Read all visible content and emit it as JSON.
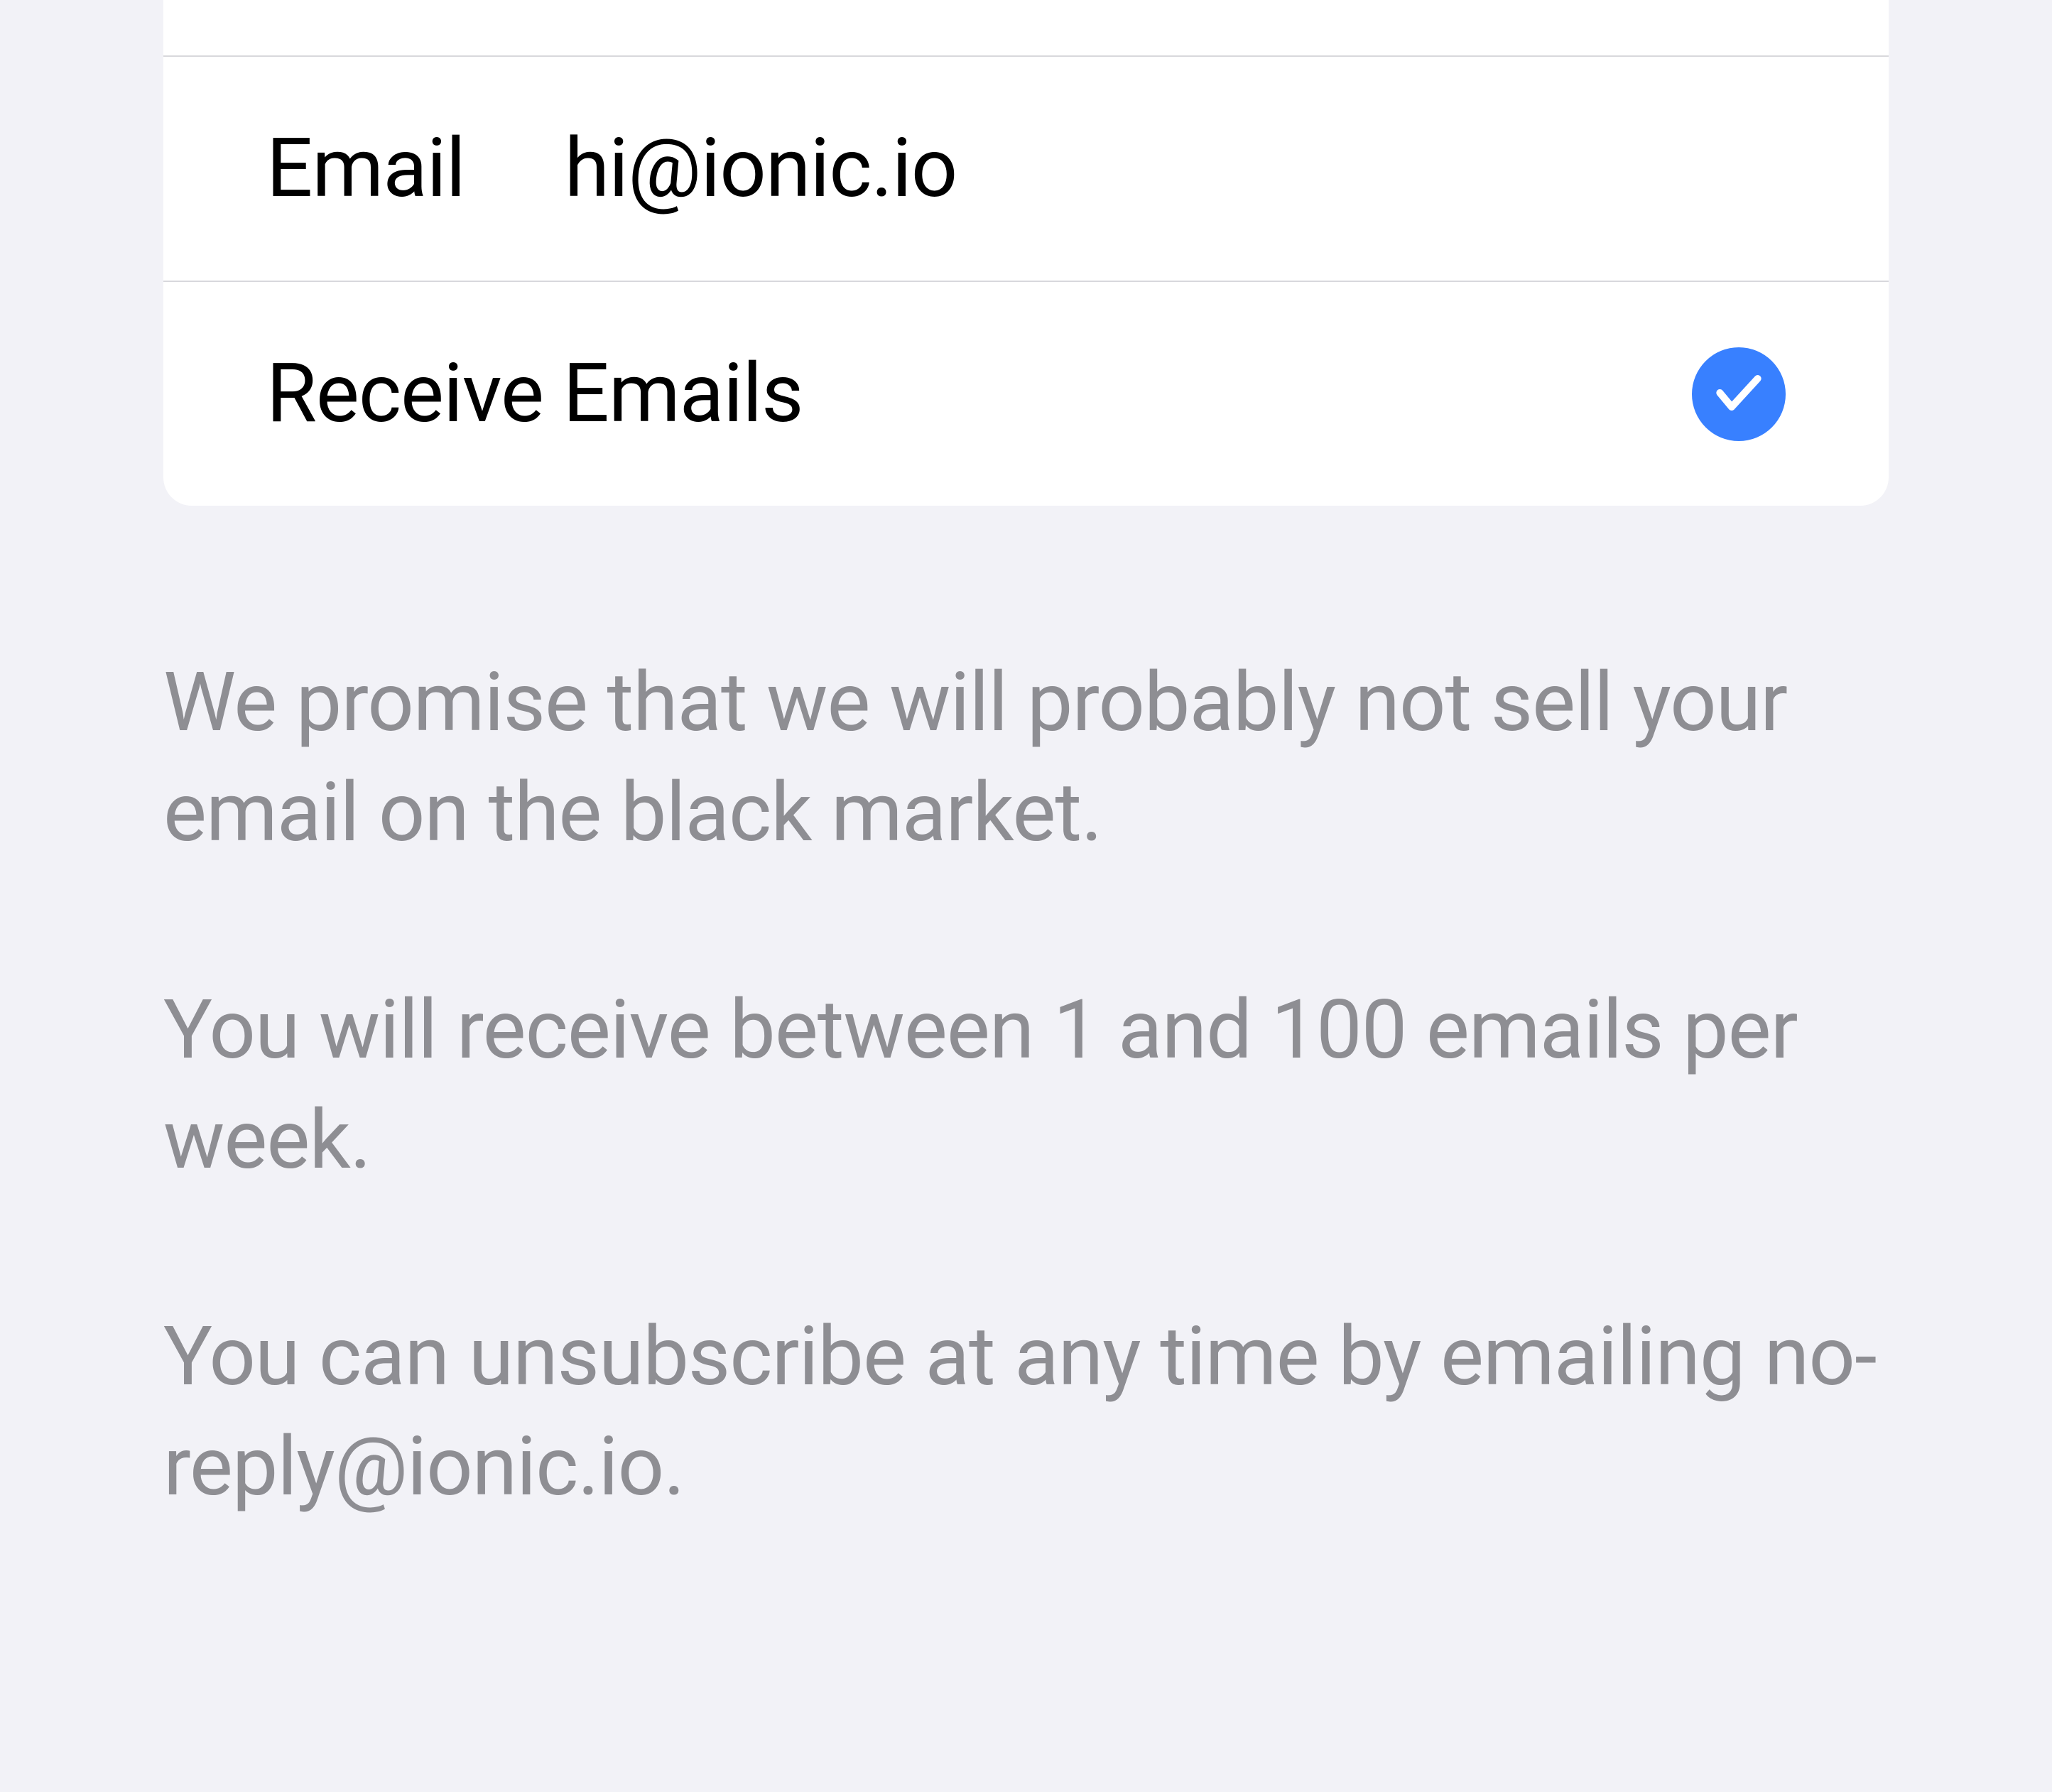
{
  "settings": {
    "emailRow": {
      "label": "Email",
      "value": "hi@ionic.io"
    },
    "receiveRow": {
      "label": "Receive Emails",
      "checked": true
    }
  },
  "description": {
    "paragraph1": "We promise that we will probably not sell your email on the black market.",
    "paragraph2": "You will receive between 1 and 100 emails per week.",
    "paragraph3": "You can unsubscribe at any time by emailing no-reply@ionic.io."
  },
  "colors": {
    "accent": "#3880ff",
    "background": "#f2f2f7",
    "textPrimary": "#000000",
    "textSecondary": "#8e8e93",
    "divider": "#d8d8dc"
  }
}
